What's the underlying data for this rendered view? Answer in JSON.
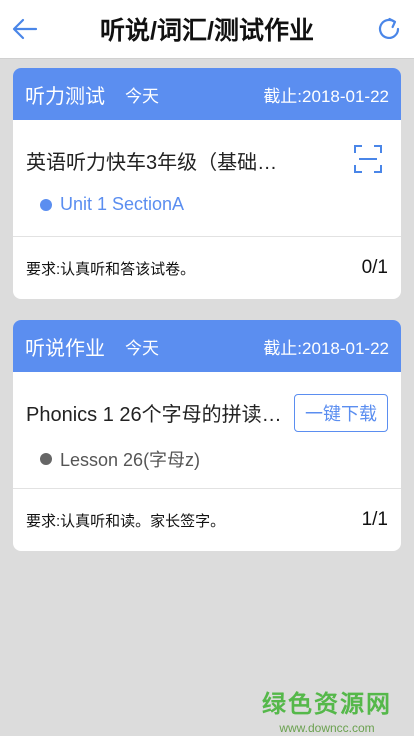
{
  "header": {
    "title": "听说/词汇/测试作业"
  },
  "assignments": [
    {
      "type": "听力测试",
      "day": "今天",
      "deadline": "截止:2018-01-22",
      "title": "英语听力快车3年级（基础…",
      "unit": "Unit 1 SectionA",
      "unit_color": "#5b8ef0",
      "action": "scan",
      "requirement": "要求:认真听和答该试卷。",
      "progress": "0/1"
    },
    {
      "type": "听说作业",
      "day": "今天",
      "deadline": "截止:2018-01-22",
      "title": "Phonics 1 26个字母的拼读…",
      "unit": "Lesson 26(字母z)",
      "unit_color": "#666666",
      "action_label": "一键下载",
      "requirement": "要求:认真听和读。家长签字。",
      "progress": "1/1"
    }
  ],
  "watermark": {
    "brand": "绿色资源网",
    "url": "www.downcc.com"
  },
  "colors": {
    "accent": "#5b8ef0",
    "background": "#dcdcdc",
    "watermark": "#55b84a"
  }
}
